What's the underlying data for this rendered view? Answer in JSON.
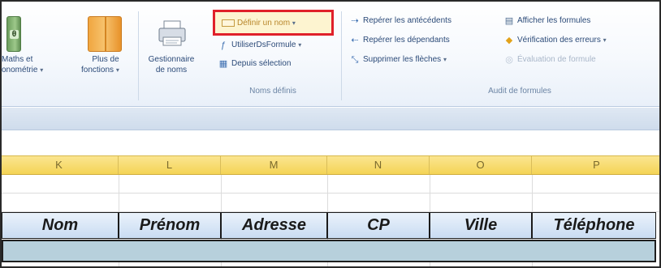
{
  "ribbon": {
    "math_button": {
      "line1": "Maths et",
      "line2": "onométrie",
      "caret": "▾"
    },
    "more_functions_button": {
      "line1": "Plus de",
      "line2": "fonctions",
      "caret": "▾"
    },
    "name_manager_button": {
      "line1": "Gestionnaire",
      "line2": "de noms"
    },
    "define_name": {
      "label": "Définir un nom",
      "caret": "▾"
    },
    "use_in_formula": {
      "label": "UtiliserDsFormule",
      "caret": "▾"
    },
    "from_selection": {
      "label": "Depuis sélection"
    },
    "defined_names_group_label": "Noms définis",
    "trace_precedents": {
      "label": "Repérer les antécédents"
    },
    "trace_dependents": {
      "label": "Repérer les dépendants"
    },
    "remove_arrows": {
      "label": "Supprimer les flèches",
      "caret": "▾"
    },
    "show_formulas": {
      "label": "Afficher les formules"
    },
    "error_checking": {
      "label": "Vérification des erreurs",
      "caret": "▾"
    },
    "evaluate_formula": {
      "label": "Évaluation de formule"
    },
    "formula_auditing_group_label": "Audit de formules"
  },
  "grid": {
    "column_headers": [
      "K",
      "L",
      "M",
      "N",
      "O",
      "P"
    ],
    "table_headers": [
      "Nom",
      "Prénom",
      "Adresse",
      "CP",
      "Ville",
      "Téléphone"
    ]
  },
  "colors": {
    "highlight_border": "#e0202a",
    "column_header_bg": "#f4d456",
    "table_header_bg": "#c9dcf2",
    "data_row_bg": "#b7d0dc"
  }
}
